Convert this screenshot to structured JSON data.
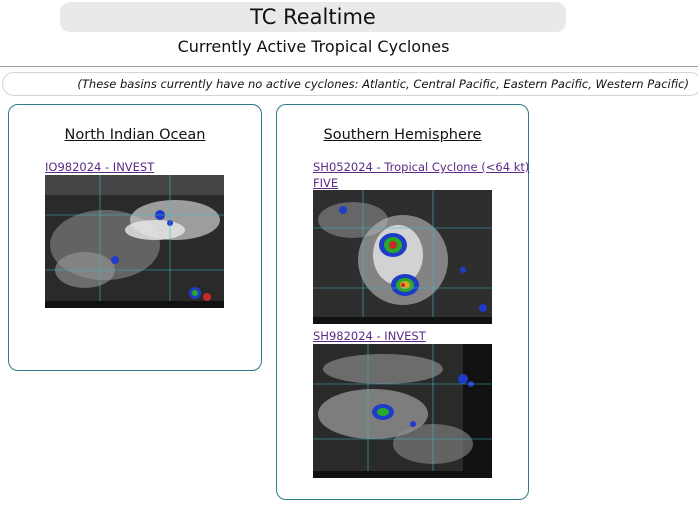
{
  "header": {
    "title": "TC Realtime",
    "subtitle": "Currently Active Tropical Cyclones"
  },
  "notice": "(These basins currently have no active cyclones: Atlantic, Central Pacific, Eastern Pacific, Western Pacific)",
  "basins": [
    {
      "name": "North Indian Ocean",
      "storms": [
        {
          "label": "IO982024 - INVEST",
          "image_icon": "satellite-ir-image"
        }
      ]
    },
    {
      "name": "Southern Hemisphere",
      "storms": [
        {
          "label_line1": "SH052024 - Tropical Cyclone (<64 kt)",
          "label_line2": "FIVE",
          "image_icon": "satellite-ir-image"
        },
        {
          "label": "SH982024 - INVEST",
          "image_icon": "satellite-ir-image"
        }
      ]
    }
  ],
  "colors": {
    "panel_border": "#2e7b8c",
    "link": "#5b2a86",
    "title_bar": "#e9e9e9"
  }
}
